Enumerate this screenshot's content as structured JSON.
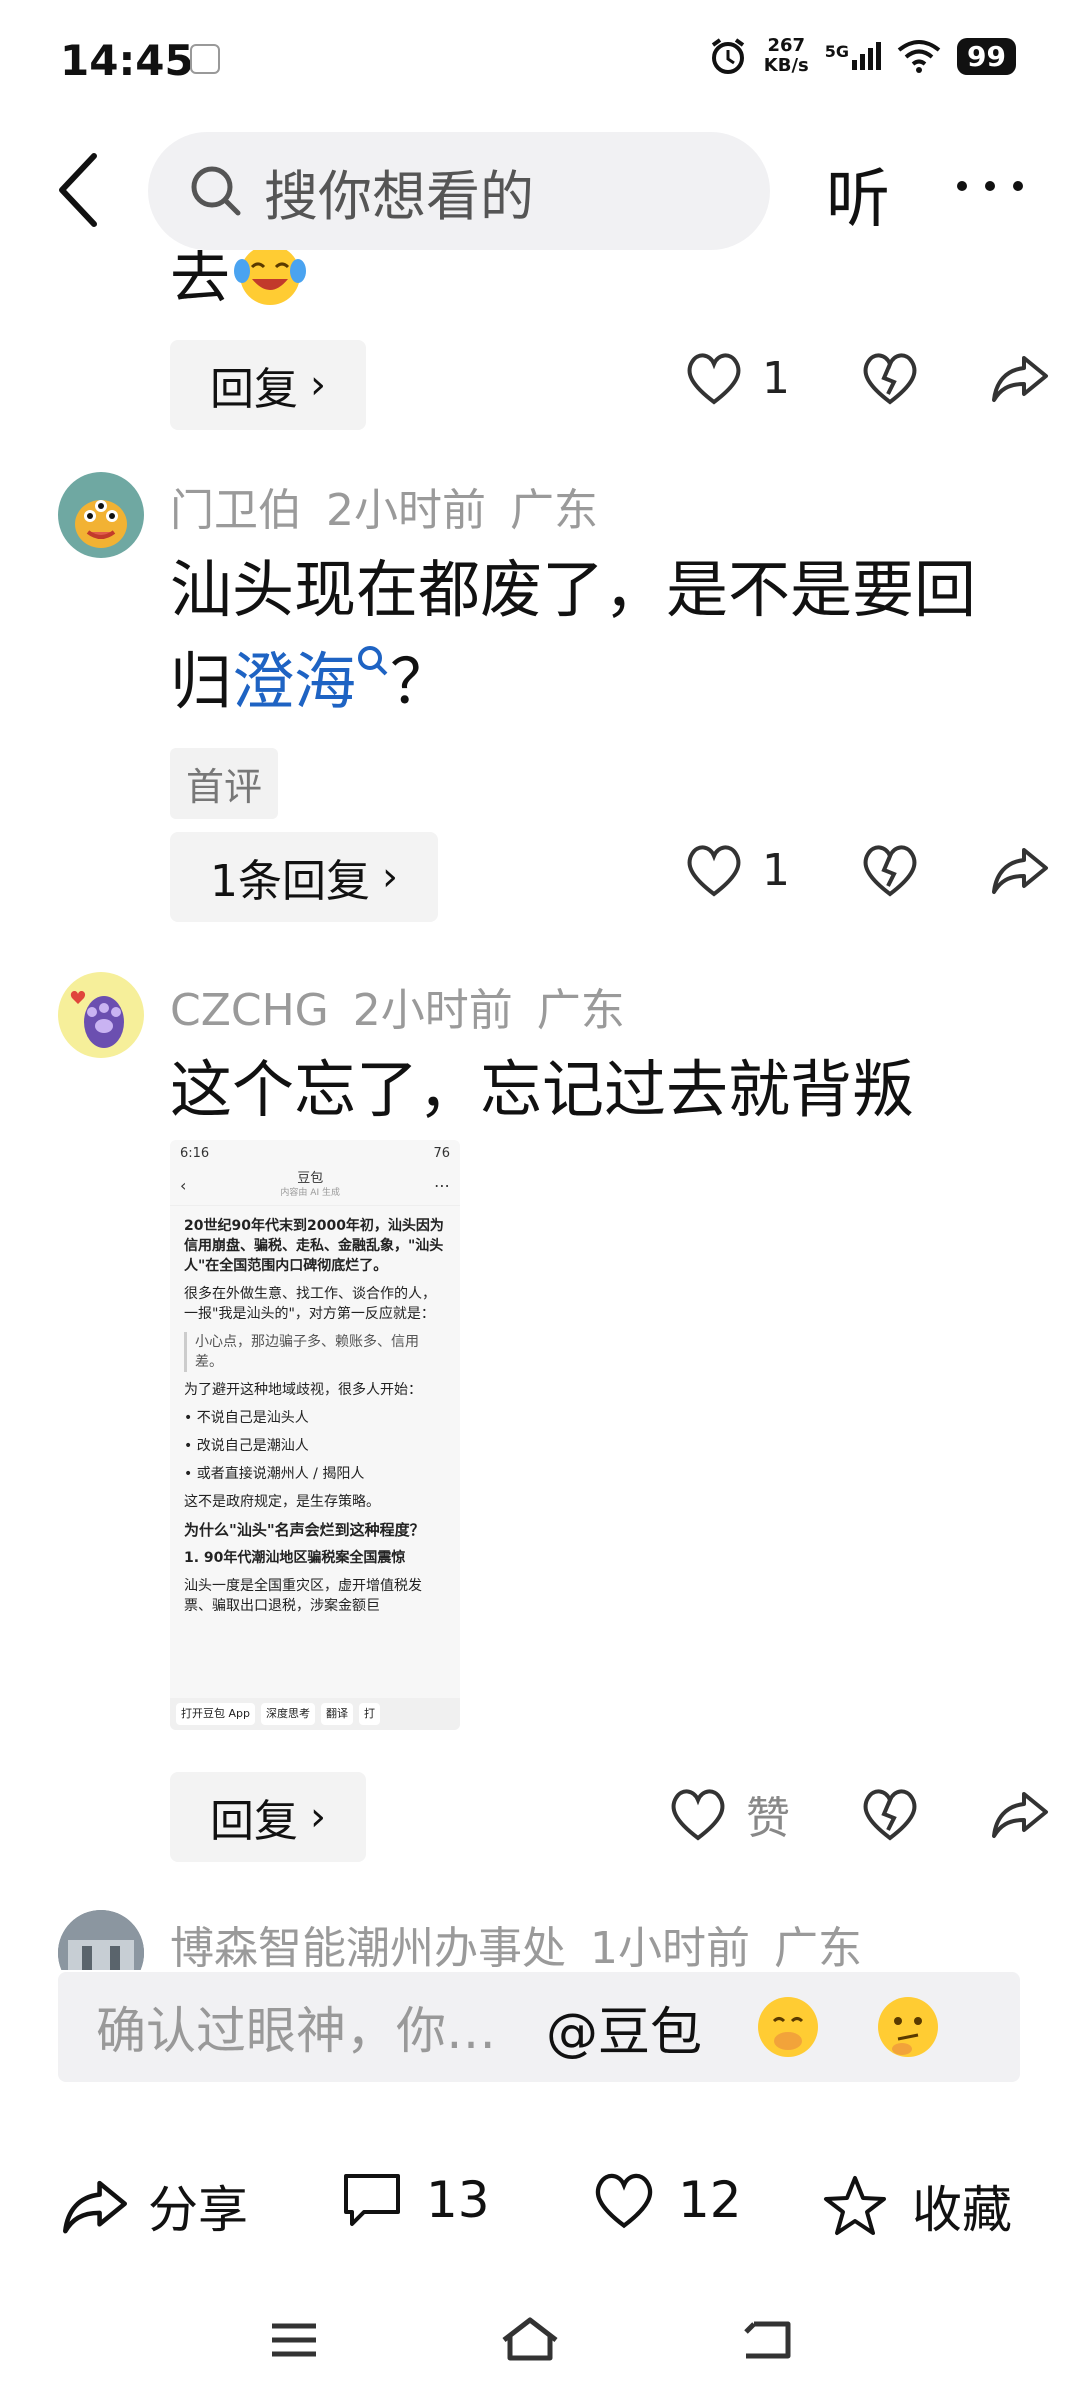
{
  "status": {
    "time": "14:45",
    "net_speed_value": "267",
    "net_speed_unit": "KB/s",
    "network": "5G",
    "battery": "99"
  },
  "search": {
    "placeholder": "搜你想看的",
    "listen_label": "听"
  },
  "partial_comment": {
    "text_tail": "去",
    "reply_label": "回复",
    "like_count": "1"
  },
  "comments": [
    {
      "author": "门卫伯",
      "time": "2小时前",
      "location": "广东",
      "text_before": "汕头现在都废了，是不是要回归",
      "keyword": "澄海",
      "text_after": "？",
      "tag": "首评",
      "reply_label": "1条回复",
      "like_count": "1"
    },
    {
      "author": "CZCHG",
      "time": "2小时前",
      "location": "广东",
      "text": "这个忘了，忘记过去就背叛",
      "reply_label": "回复",
      "like_label": "赞",
      "image": {
        "time": "6:16",
        "battery": "76",
        "title": "豆包",
        "subtitle": "内容由 AI 生成",
        "p1": "20世纪90年代末到2000年初，汕头因为信用崩盘、骗税、走私、金融乱象，\"汕头人\"在全国范围内口碑彻底烂了。",
        "p2": "很多在外做生意、找工作、谈合作的人，一报\"我是汕头的\"，对方第一反应就是：",
        "quote": "小心点，那边骗子多、赖账多、信用差。",
        "p3": "为了避开这种地域歧视，很多人开始：",
        "li1": "不说自己是汕头人",
        "li2": "改说自己是潮汕人",
        "li3": "或者直接说潮州人 / 揭阳人",
        "p4": "这不是政府规定，是生存策略。",
        "h2": "为什么\"汕头\"名声会烂到这种程度？",
        "n1": "1. 90年代潮汕地区骗税案全国震惊",
        "n1b": "汕头一度是全国重灾区，虚开增值税发票、骗取出口退税，涉案金额巨",
        "btn1": "打开豆包 App",
        "btn2": "深度思考",
        "btn3": "翻译",
        "btn4": "打"
      }
    },
    {
      "author": "博森智能潮州办事处",
      "time": "1小时前",
      "location": "广东"
    }
  ],
  "input": {
    "placeholder": "确认过眼神，你…",
    "doubao": "@豆包"
  },
  "bottom_bar": {
    "share_label": "分享",
    "comment_count": "13",
    "like_count": "12",
    "collect_label": "收藏"
  },
  "colors": {
    "keyword": "#1e63c3",
    "meta": "#9a9a9a",
    "search_bg": "#f1f1f3"
  },
  "icons": [
    "back-arrow-icon",
    "search-icon",
    "more-icon",
    "heart-icon",
    "broken-heart-icon",
    "share-arrow-icon",
    "comment-icon",
    "star-icon",
    "menu-icon",
    "home-icon",
    "return-icon"
  ]
}
